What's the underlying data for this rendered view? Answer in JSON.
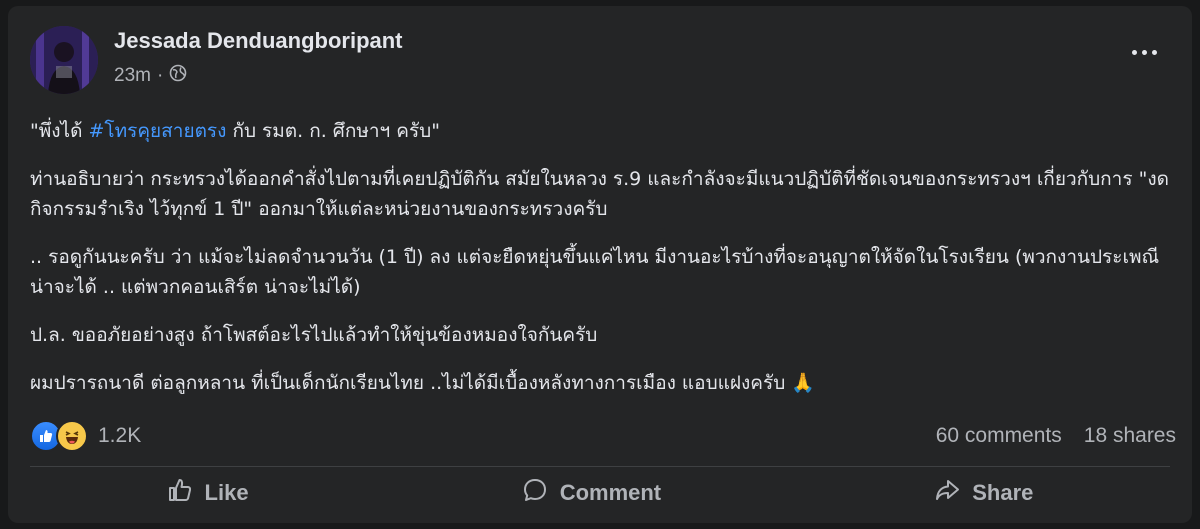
{
  "post": {
    "author": "Jessada Denduangboripant",
    "time": "23m",
    "paragraphs": {
      "p1_open": "\"พึ่งได้ ",
      "p1_hashtag": "#โทรคุยสายตรง",
      "p1_close": " กับ รมต. ก. ศึกษาฯ ครับ\"",
      "p2": "ท่านอธิบายว่า กระทรวงได้ออกคำสั่งไปตามที่เคยปฏิบัติกัน สมัยในหลวง ร.9  และกำลังจะมีแนวปฏิบัติที่ชัดเจนของกระทรวงฯ เกี่ยวกับการ \"งดกิจกรรมรำเริง ไว้ทุกข์ 1 ปี\"  ออกมาให้แต่ละหน่วยงานของกระทรวงครับ",
      "p3": ".. รอดูกันนะครับ ว่า แม้จะไม่ลดจำนวนวัน (1 ปี) ลง แต่จะยืดหยุ่นขึ้นแค่ไหน มีงานอะไรบ้างที่จะอนุญาตให้จัดในโรงเรียน (พวกงานประเพณี น่าจะได้ .. แต่พวกคอนเสิร์ต น่าจะไม่ได้)",
      "p4": "ป.ล. ขออภัยอย่างสูง ถ้าโพสต์อะไรไปแล้วทำให้ขุ่นข้องหมองใจกันครับ",
      "p5": "ผมปรารถนาดี ต่อลูกหลาน ที่เป็นเด็กนักเรียนไทย ..ไม่ได้มีเบื้องหลังทางการเมือง แอบแฝงครับ 🙏"
    },
    "reactions_count": "1.2K",
    "comments": "60 comments",
    "shares": "18 shares"
  },
  "actions": {
    "like": "Like",
    "comment": "Comment",
    "share": "Share"
  },
  "colors": {
    "background": "#18191a",
    "card": "#242526",
    "text": "#e4e6eb",
    "secondary": "#b0b3b8",
    "hashtag": "#4599ff"
  },
  "icons": {
    "privacy": "globe-icon",
    "more": "more-options-icon",
    "reaction_1": "like-reaction-icon",
    "reaction_2": "haha-reaction-icon",
    "like": "thumbs-up-icon",
    "comment": "comment-bubble-icon",
    "share": "share-arrow-icon"
  }
}
